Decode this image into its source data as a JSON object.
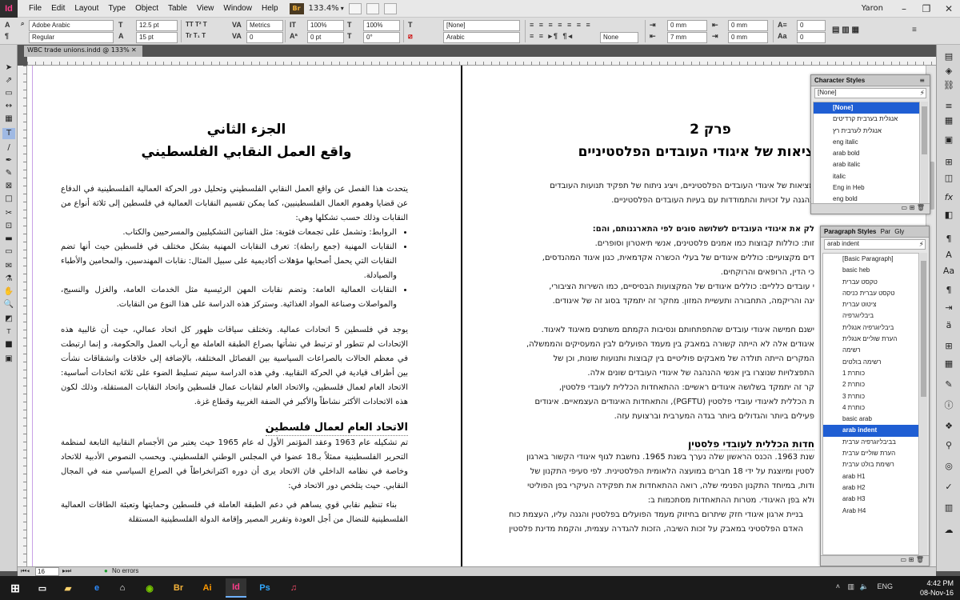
{
  "menubar": {
    "app_logo": "Id",
    "items": [
      "File",
      "Edit",
      "Layout",
      "Type",
      "Object",
      "Table",
      "View",
      "Window",
      "Help"
    ],
    "bridge_badge": "Br",
    "zoom": "133.4%",
    "user": "Yaron"
  },
  "control": {
    "font_family": "Adobe Arabic",
    "font_style": "Regular",
    "font_size": "12.5 pt",
    "leading": "15 pt",
    "kerning": "Metrics",
    "tracking": "0",
    "vert_scale": "100%",
    "horiz_scale": "100%",
    "baseline": "0 pt",
    "skew": "0°",
    "char_style": "[None]",
    "language": "Arabic",
    "indent_left": "0 mm",
    "indent_right": "0 mm",
    "space_before": "0 mm",
    "space_after": "7 mm",
    "dropcap_lines": "0",
    "dropcap_chars": "0",
    "para_none": "None"
  },
  "document": {
    "tab_title": "WBC trade unions.indd @ 133%",
    "left_page": {
      "title_line1": "الجزء الثاني",
      "title_line2": "واقع العمل النقابي الفلسطيني",
      "intro": "يتحدث هذا الفصل عن واقع العمل النقابي الفلسطيني وتحليل دور الحركة العمالية الفلسطينية في الدفاع عن قضايا وهموم العمال الفلسطينيين، كما يمكن تقسيم النقابات العمالية في فلسطين إلى ثلاثة أنواع من النقابات وذلك حسب تشكلها وهي:",
      "bullets": [
        "الروابط: وتشمل على تجمعات فئوية: مثل الفنانين التشكيليين والمسرحيين والكتاب.",
        "النقابات المهنية (جمع رابطة): تعرف النقابات المهنية بشكل مختلف في فلسطين حيث أنها تضم النقابات التي يحمل أصحابها مؤهلات أكاديمية على سبيل المثال: نقابات المهندسين، والمحامين والأطباء والصيادلة.",
        "النقابات العمالية العامة: وتضم نقابات المهن الرئيسية مثل الخدمات العامة، والغزل والنسيج، والمواصلات وصناعة المواد الغذائية. وستركز هذه الدراسة على هذا النوع من النقابات."
      ],
      "para2": "يوجد في فلسطين 5 اتحادات عمالية. وتختلف سياقات ظهور كل اتحاد عمالي، حيث أن غالبية هذه الإتحادات لم تتطور او ترتبط في نشأتها بصراع الطبقة العاملة مع أرباب العمل والحكومة، و إنما ارتبطت في معظم الحالات بالصراعات السياسية بين الفصائل المختلفة، بالإضافة إلى خلافات وانشقاقات نشأت بين أطراف قيادية في الحركة النقابية. وفي هذه الدراسة سيتم تسليط الضوء على ثلاثة اتحادات أساسية: الاتحاد العام لعمال فلسطين، والاتحاد العام لنقابات عمال فلسطين واتحاد النقابات المستقلة، وذلك لكون هذه الاتحادات الأكثر نشاطاً والأكبر في الضفة الغربية وقطاع غزة.",
      "subheading": "الاتحاد العام لعمال فلسطين",
      "para3": "تم تشكيله عام 1963 وعقد المؤتمر الأول له عام 1965 حيث يعتبر من الأجسام النقابية التابعة لمنظمة التحرير الفلسطينية ممثلاً بـ18 عضوا في المجلس الوطني الفلسطيني. ويحسب النصوص الأدبية للاتحاد وخاصة في نظامه الداخلي فان الاتحاد يرى أن دوره اكثرانخراطاً في الصراع السياسي منه في المجال النقابي. حيث يتلخص دور الاتحاد في:",
      "para4": "بناء تنظيم نقابي قوي يساهم في دعم الطبقة العاملة في فلسطين وحمايتها وتعبئة الطاقات العمالية الفلسطينية للنضال من أجل العودة وتقرير المصير وإقامة الدولة الفلسطينية المستقلة"
    },
    "right_page": {
      "chapter": "פרק 2",
      "title": "ציאות של איגודי העובדים הפלסטיניים",
      "lines": [
        "מציאות של איגודי העובדים הפלסטיניים, ויציג ניתוח של תפקיד תנועות העובדים",
        "בהגנה על זכויות והתמודדות עם בעיות העובדים הפלסטיניים.",
        "",
        "לק את איגודי העובדים לשלושה סוגים לפי התארגנותם, והם:",
        "זות: כוללות קבוצות כמו אמנים פלסטינים, אנשי תיאטרון וסופרים.",
        "דים מקצועיים: כוללים איגודים של בעלי הכשרה אקדמאית, כגון איגוד המהנדסים,",
        "כי הדין, הרופאים והרוקחים.",
        "י עובדים כלליים: כוללים איגודים של המקצועות הבסיסיים, כמו השירות הציבורי,",
        "יגה והריקמה, התחבורה ותעשיית המזון. מחקר זה יתמקד בסוג זה של איגודים.",
        "",
        "ישנם חמישה איגודי עובדים שהתפתחותם ונסיבות הקמתם משתנים מאיגוד לאיגוד.",
        "איגודים אלה לא הייתה קשורה במאבק בין מעמד הפועלים לבין המעסיקים והממשלה,",
        "המקרים הייתה תולדה של מאבקים פוליטיים בין קבוצות ותנועות שונות, וכן של",
        "התפצלויות שנוצרו בין אנשי ההנהגה של איגודי העובדים שונים אלה.",
        "קר זה יתמקד בשלושה איגודים ראשיים: ההתאחדות הכללית לעובדי פלסטין,",
        "ת הכללית לאיגודי עובדי פלסטין (PGFTU), והתאחדות האיגודים העצמאיים. איגודים",
        "פעילים ביותר והגדולים ביותר בגדה המערבית וברצועת עזה."
      ],
      "subheading": "חדות הכללית לעובדי פלסטין",
      "lines2": [
        "שנת 1963. הכנס הראשון שלה נערך בשנת 1965. נחשבת לגוף איגודי הקשור בארגון",
        "לסטין ומיוצגת על ידי 18 חברים במועצה הלאומית הפלסטינית. לפי סעיפי התקנון של",
        "ודות, במיוחד התקנון הפנימי שלה, רואה ההתאחדות את תפקידה העיקרי בפן הפוליטי",
        "ולא בפן האיגודי. מטרות ההתאחדות מסתכמות ב:",
        "בניית ארגון איגודי חזק שיתרום בחיזוק מעמד הפועלים בפלסטין והגנה עליו, העצמת כוח",
        "האדם הפלסטיני במאבק על זכות השיבה, הזכות להגדרה עצמית, והקמת מדינת פלסטין"
      ]
    }
  },
  "char_styles_panel": {
    "title": "Character Styles",
    "current": "[None]",
    "items": [
      "[None]",
      "אנגלית בערבית קרדיטים",
      "אנגלית לערבית רץ",
      "eng italic",
      "arab bold",
      "arab italic",
      "italic",
      "Eng in Heb",
      "eng bold"
    ],
    "selected_index": 0
  },
  "para_styles_panel": {
    "title": "Paragraph Styles",
    "tab2": "Par",
    "tab3": "Gly",
    "current": "arab indent",
    "items": [
      "[Basic Paragraph]",
      "basic heb",
      "טקסט עברית",
      "טקסט עברית כניסה",
      "ציטוט עברית",
      "ביבליוגרפיה",
      "ביבליוגרפיה אנגלית",
      "הערת שוליים אנגלית",
      "רשימה",
      "רשימה בולטים",
      "כותרת 1",
      "כותרת 2",
      "כותרת 3",
      "כותרת 4",
      "basic arab",
      "arab indent",
      "בביבליוגרפיה ערבית",
      "הערת שוליים ערבית",
      "רשימת בולט ערבית",
      "arab H1",
      "arab H2",
      "arab H3",
      "Arab H4"
    ],
    "selected_index": 15
  },
  "status": {
    "zoom": "16",
    "errors": "No errors"
  },
  "taskbar": {
    "language": "ENG",
    "time": "4:42 PM",
    "date": "08-Nov-16",
    "apps": [
      "Br",
      "Ai",
      "Id",
      "Ps"
    ]
  }
}
